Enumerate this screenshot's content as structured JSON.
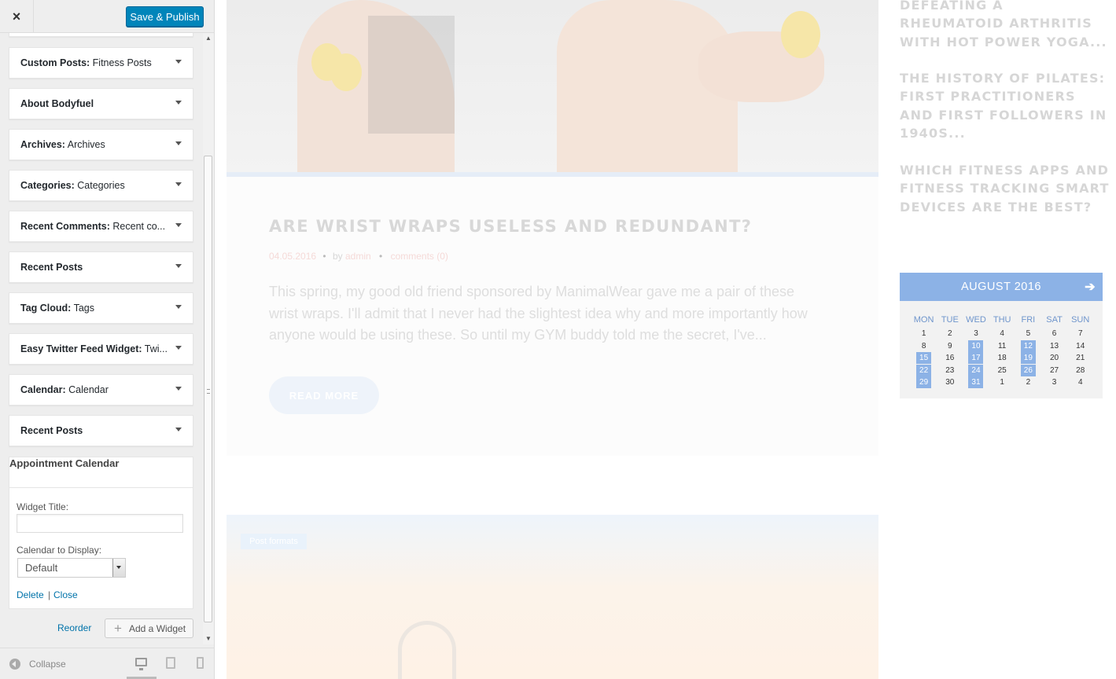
{
  "topbar": {
    "close_icon": "×",
    "save_label": "Save & Publish"
  },
  "widgets": [
    {
      "bold": "Custom Posts:",
      "rest": " Fitness Posts"
    },
    {
      "bold": "About Bodyfuel",
      "rest": ""
    },
    {
      "bold": "Archives:",
      "rest": " Archives"
    },
    {
      "bold": "Categories:",
      "rest": " Categories"
    },
    {
      "bold": "Recent Comments:",
      "rest": " Recent co..."
    },
    {
      "bold": "Recent Posts",
      "rest": ""
    },
    {
      "bold": "Tag Cloud:",
      "rest": " Tags"
    },
    {
      "bold": "Easy Twitter Feed Widget:",
      "rest": " Twi..."
    },
    {
      "bold": "Calendar:",
      "rest": " Calendar"
    },
    {
      "bold": "Recent Posts",
      "rest": ""
    }
  ],
  "open_widget": {
    "title": "Appointment Calendar",
    "field_title_label": "Widget Title:",
    "field_title_value": "",
    "field_calendar_label": "Calendar to Display:",
    "field_calendar_value": "Default",
    "delete_label": "Delete",
    "separator": "|",
    "close_label": "Close"
  },
  "panel_actions": {
    "reorder_label": "Reorder",
    "add_widget_label": "Add a Widget",
    "add_icon": "+"
  },
  "footer": {
    "collapse_label": "Collapse"
  },
  "preview": {
    "post": {
      "title": "ARE WRIST WRAPS USELESS AND REDUNDANT?",
      "date": "04.05.2016",
      "by_label": "by",
      "author": "admin",
      "comments": "comments (0)",
      "bullet": "•",
      "excerpt": "This spring, my good old friend sponsored by ManimalWear gave me a pair of these wrist wraps. I'll admit that I never had the slightest idea why and more importantly how anyone would be using these. So until my GYM buddy told me the secret, I've...",
      "read_more": "READ MORE"
    },
    "next_post_badge": "Post formats",
    "side_posts": [
      "DEFEATING A RHEUMATOID ARTHRITIS WITH HOT POWER YOGA...",
      "THE HISTORY OF PILATES: FIRST PRACTITIONERS AND FIRST FOLLOWERS IN 1940S...",
      "WHICH FITNESS APPS AND FITNESS TRACKING SMART DEVICES ARE THE BEST?"
    ],
    "calendar": {
      "month": "AUGUST 2016",
      "next_icon": "➔",
      "days": [
        "MON",
        "TUE",
        "WED",
        "THU",
        "FRI",
        "SAT",
        "SUN"
      ],
      "weeks": [
        [
          "1",
          "2",
          "3",
          "4",
          "5",
          "6",
          "7"
        ],
        [
          "8",
          "9",
          "10",
          "11",
          "12",
          "13",
          "14"
        ],
        [
          "15",
          "16",
          "17",
          "18",
          "19",
          "20",
          "21"
        ],
        [
          "22",
          "23",
          "24",
          "25",
          "26",
          "27",
          "28"
        ],
        [
          "29",
          "30",
          "31",
          "1",
          "2",
          "3",
          "4"
        ]
      ],
      "highlighted": [
        "10",
        "12",
        "15",
        "17",
        "19",
        "22",
        "24",
        "26",
        "29",
        "31"
      ],
      "accent": "#8cb2e6"
    }
  },
  "colors": {
    "primary_button": "#0085ba",
    "link": "#0073aa"
  }
}
